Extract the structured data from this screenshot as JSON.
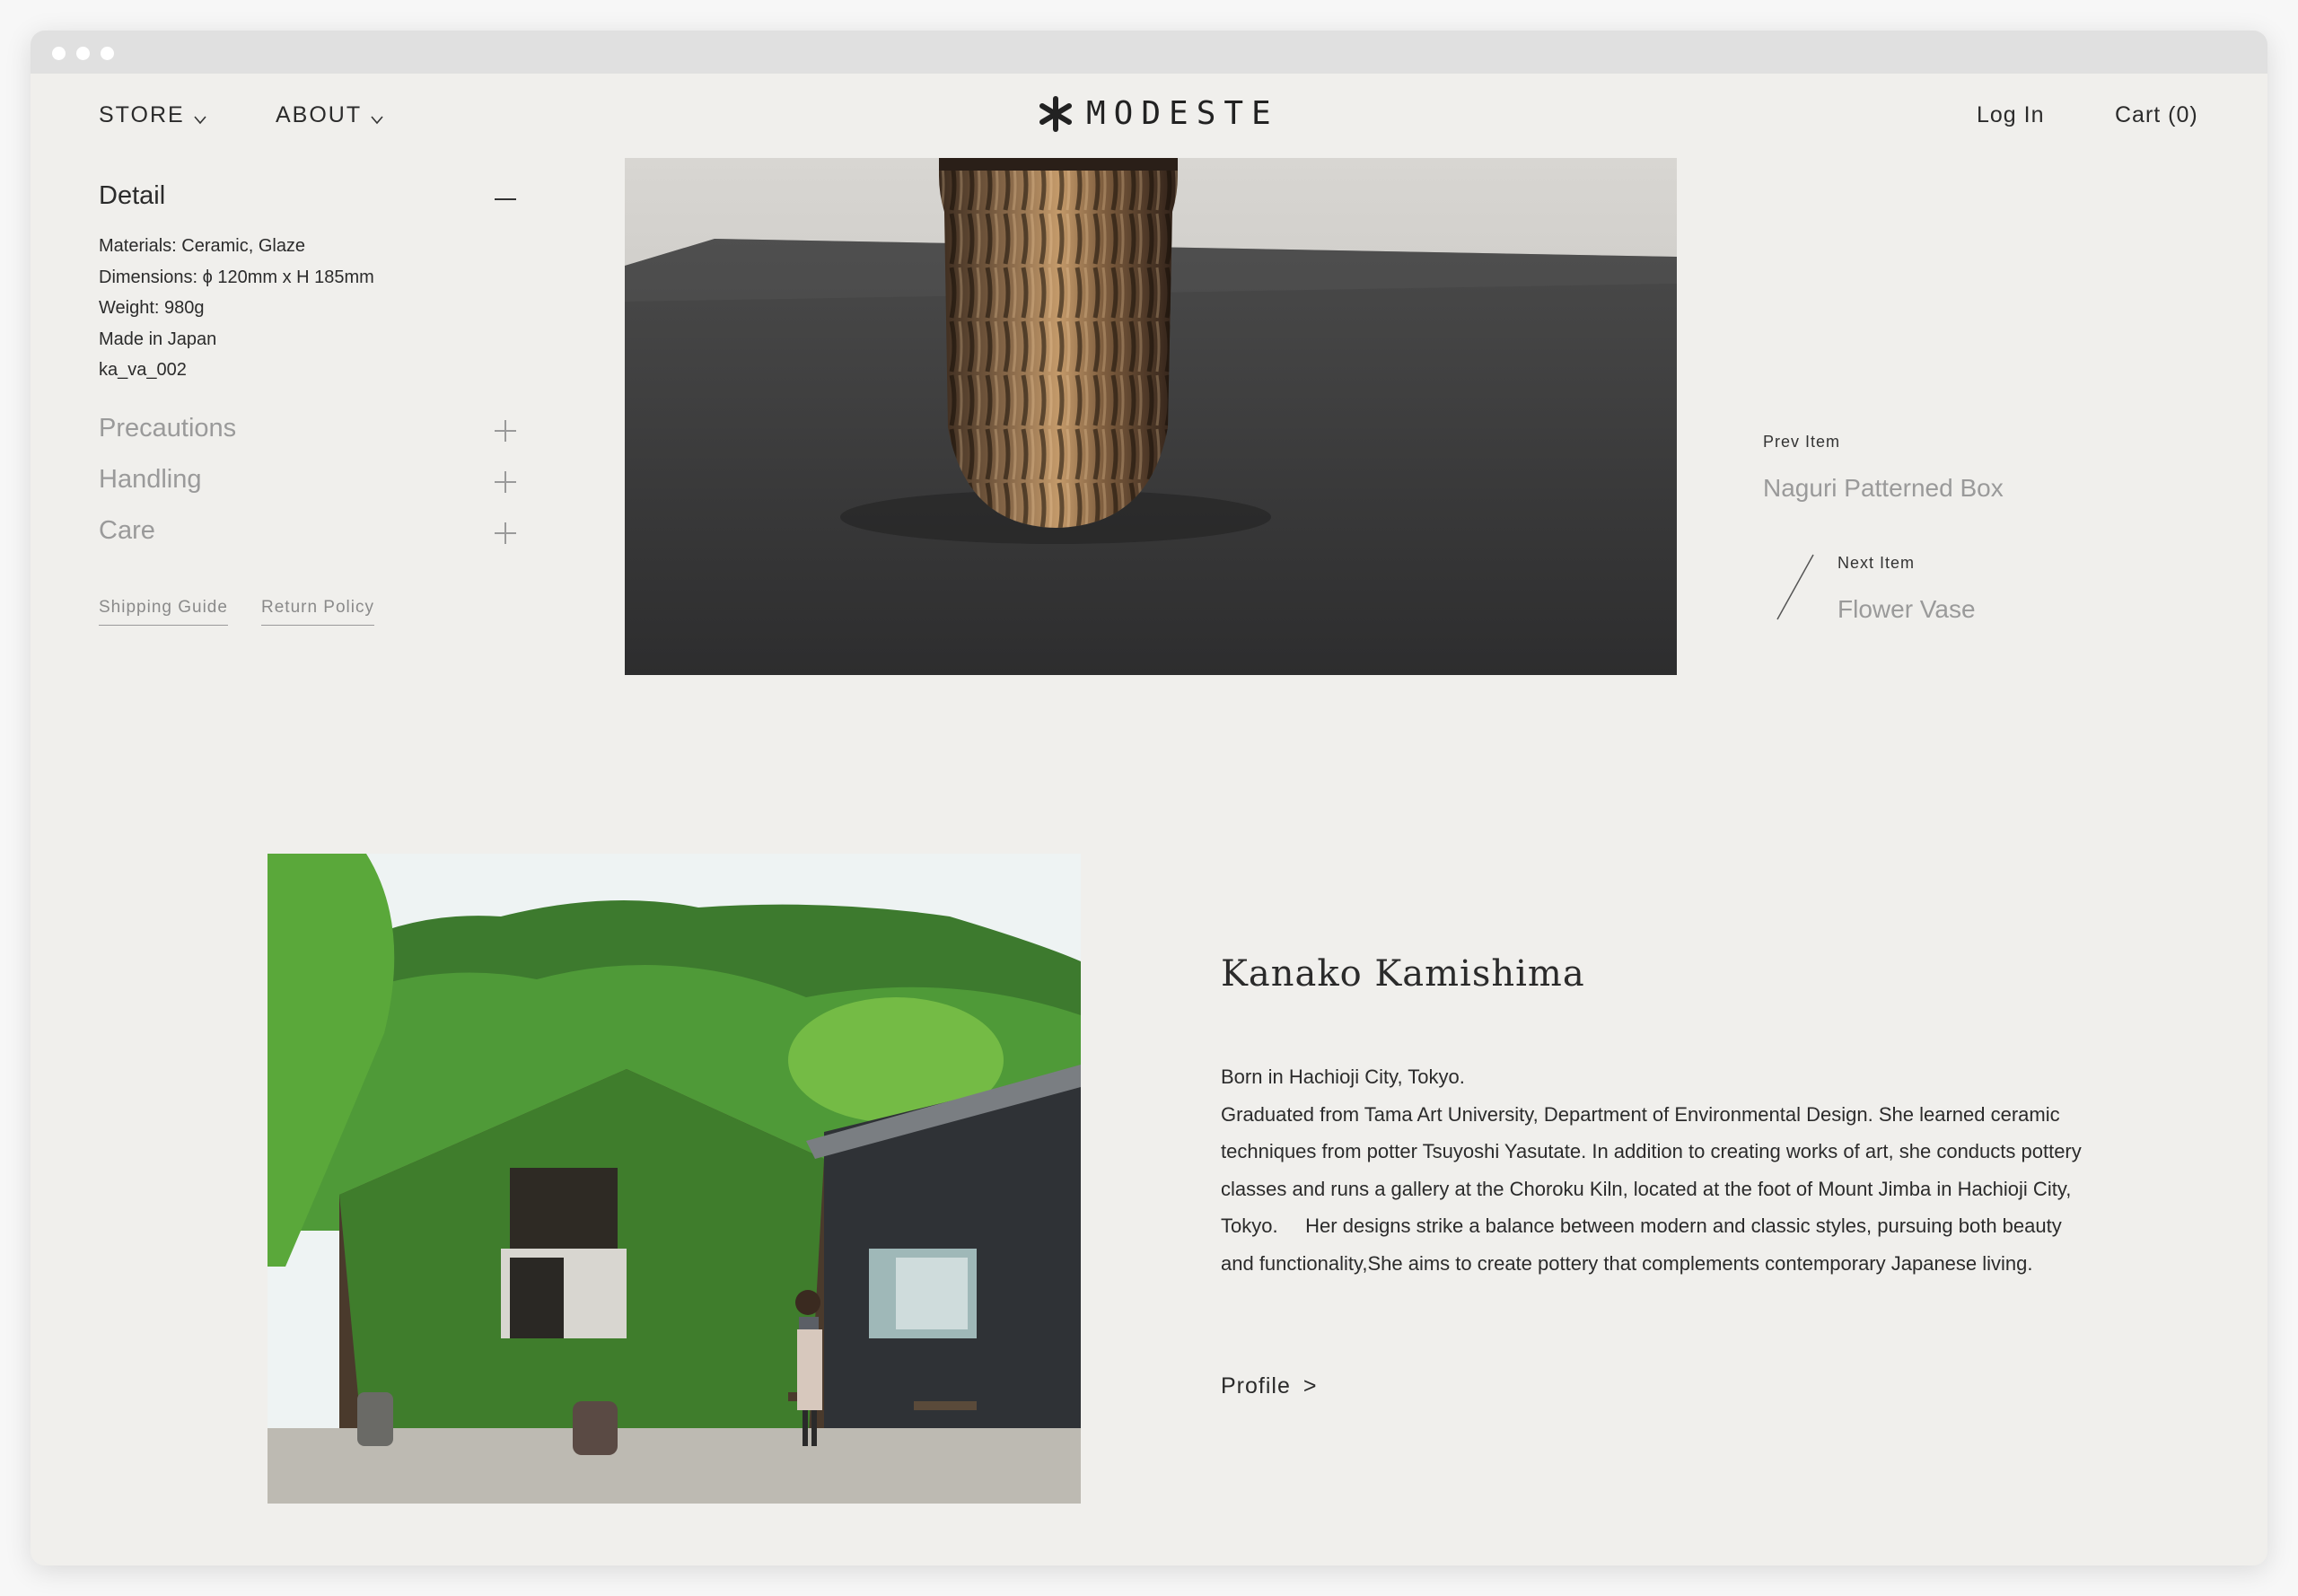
{
  "header": {
    "nav": [
      {
        "label": "STORE"
      },
      {
        "label": "ABOUT"
      }
    ],
    "logo_text": "MODESTE",
    "login_label": "Log In",
    "cart_label": "Cart (0)"
  },
  "detail": {
    "title": "Detail",
    "specs": [
      "Materials: Ceramic, Glaze",
      "Dimensions: ϕ 120mm x H 185mm",
      "Weight: 980g",
      "Made in Japan",
      "ka_va_002"
    ],
    "sections": [
      "Precautions",
      "Handling",
      "Care"
    ],
    "links": [
      "Shipping Guide",
      "Return Policy"
    ]
  },
  "navigation": {
    "prev_label": "Prev Item",
    "prev_title": "Naguri Patterned Box",
    "next_label": "Next Item",
    "next_title": "Flower Vase"
  },
  "artist": {
    "name": "Kanako Kamishima",
    "bio_line1": "Born in Hachioji City, Tokyo.",
    "bio_line2": "Graduated from Tama Art University, Department of Environmental Design. She learned ceramic techniques from potter Tsuyoshi Yasutate. In addition to creating works of art, she conducts pottery classes and runs a gallery at the Choroku Kiln, located at the foot of Mount Jimba in Hachioji City, Tokyo.     Her designs strike a balance between modern and classic styles, pursuing both beauty and functionality,She aims to create pottery that complements contemporary Japanese living.",
    "profile_label": "Profile",
    "profile_arrow": ">"
  },
  "colors": {
    "page_bg": "#f0efec",
    "text": "#2b2b2b",
    "muted": "#9a9a9a"
  }
}
